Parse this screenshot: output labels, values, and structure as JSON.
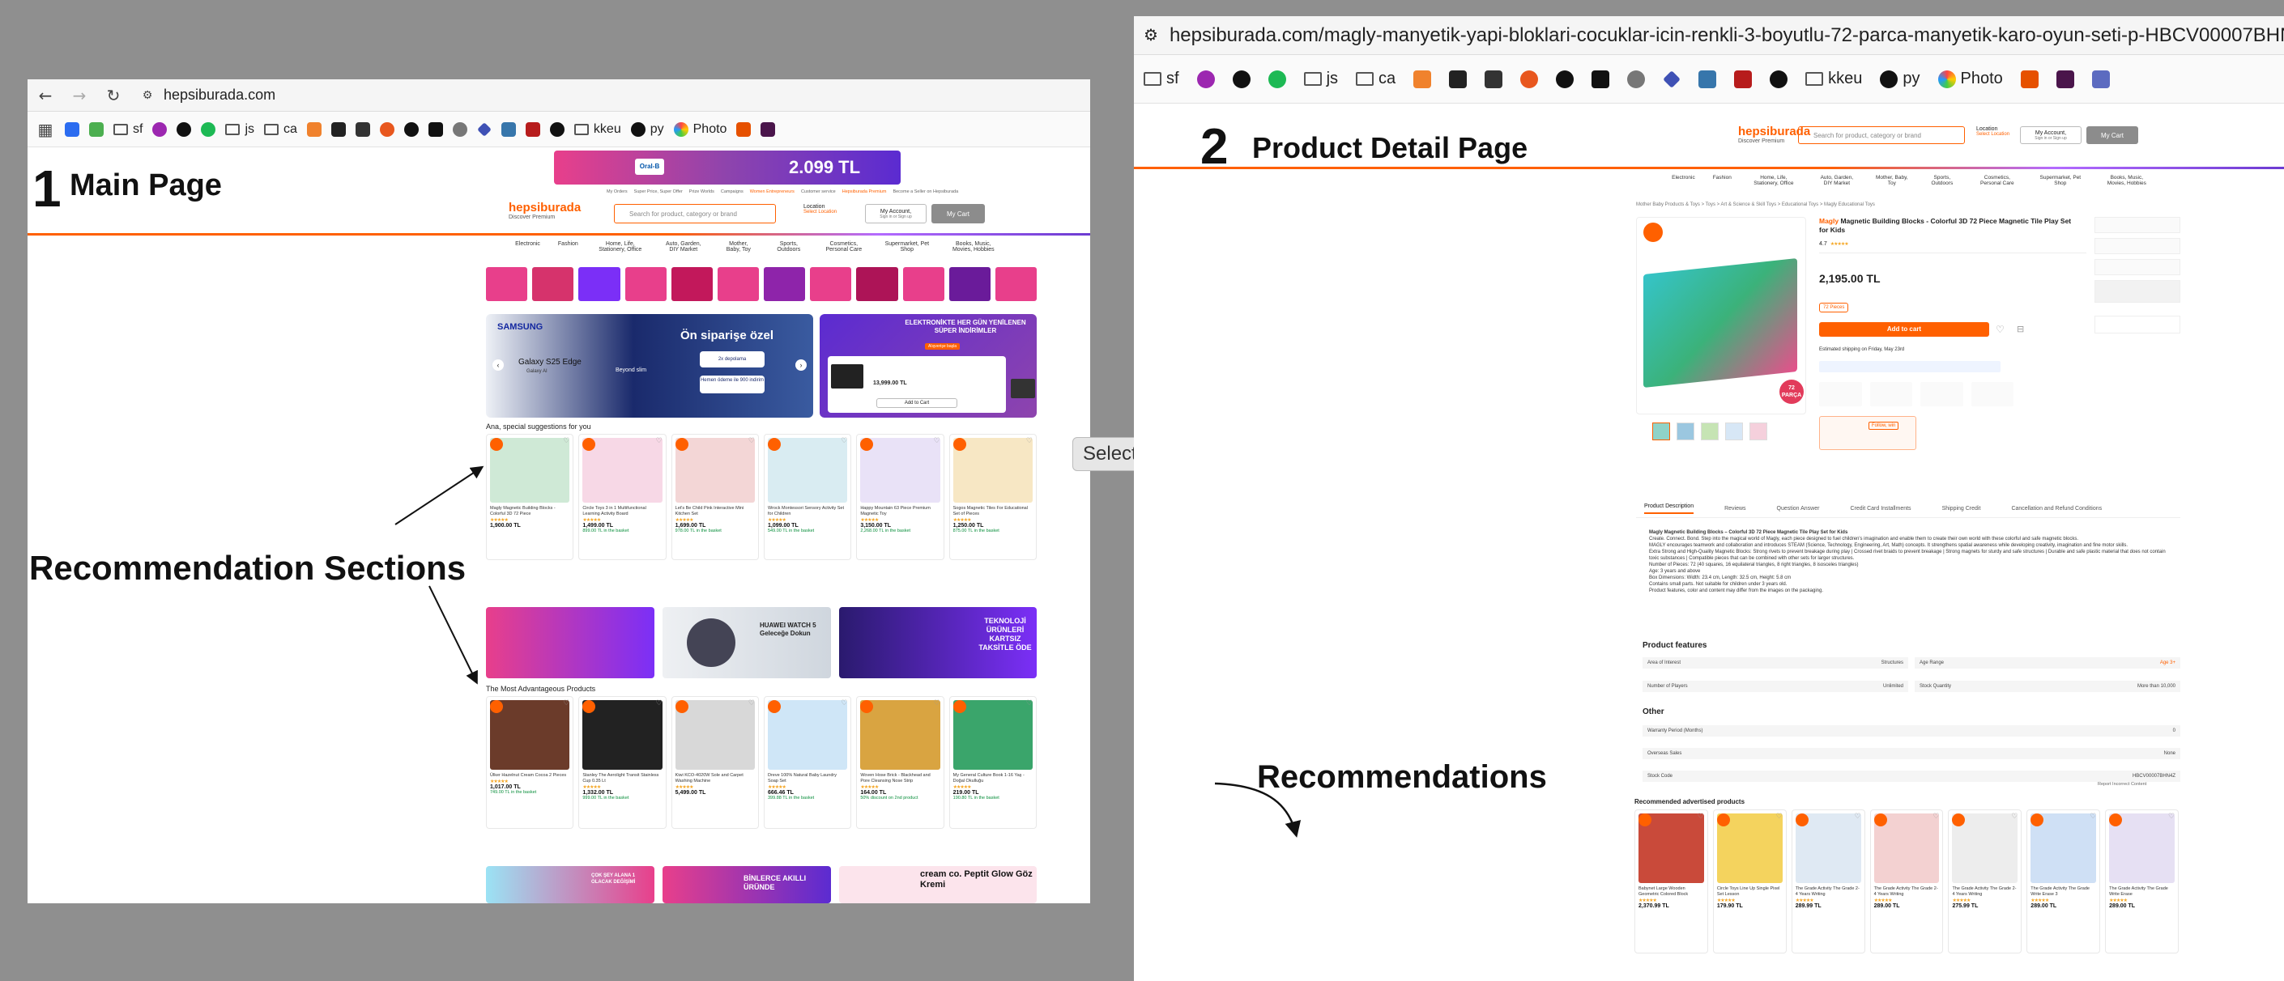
{
  "left": {
    "url": "hepsiburada.com",
    "bookmarks": [
      "sf",
      "js",
      "ca",
      "py",
      "Photo",
      "kkeu"
    ],
    "section_number": "1",
    "section_title": "Main Page",
    "site": {
      "logo": "hepsiburada",
      "logo_sub": "Discover Premium",
      "search_placeholder": "Search for product, category or brand",
      "location_label": "Location",
      "location_sub": "Select Location",
      "account_label": "My Account,",
      "account_sub": "Sign in or Sign up",
      "cart_label": "My Cart",
      "top_links": [
        "My Orders",
        "Super Price, Super Offer",
        "Prize Worlds",
        "Campaigns",
        "Women Entrepreneurs",
        "Customer service",
        "Hepsiburada Premium",
        "Become a Seller on Hepsiburada"
      ],
      "categories": [
        "Electronic",
        "Fashion",
        "Home, Life, Stationery, Office",
        "Auto, Garden, DIY Market",
        "Mother, Baby, Toy",
        "Sports, Outdoors",
        "Cosmetics, Personal Care",
        "Supermarket, Pet Shop",
        "Books, Music, Movies, Hobbies"
      ],
      "promo_price": "2.099 TL",
      "promo_brand": "Oral-B",
      "banner_left": {
        "brand": "SAMSUNG",
        "model": "Galaxy S25 Edge",
        "model_sub": "Galaxy AI",
        "tagline": "Beyond slim",
        "headline": "Ön siparişe özel",
        "pill1": "2x depolama",
        "pill2": "Hemen ödeme ile 900 indirim"
      },
      "banner_right": {
        "headline": "ELEKTRONİKTE HER GÜN YENİLENEN SÜPER İNDİRİMLER",
        "link": "Alışverişe başla",
        "price": "13,999.00 TL",
        "button": "Add to Cart"
      },
      "rec_heading": "Ana, special suggestions for you",
      "adv_heading": "The Most Advantageous Products",
      "rec_products": [
        {
          "title": "Magly Magnetic Building Blocks - Colorful 3D 72 Piece",
          "price": "1,900.00 TL",
          "green": ""
        },
        {
          "title": "Circle Toys 3 in 1 Multifunctional Learning Activity Board",
          "price": "1,499.00 TL",
          "green": "899.00 TL in the basket"
        },
        {
          "title": "Let's Be Child Pink Interactive Mini Kitchen Set",
          "price": "1,699.00 TL",
          "green": "978.00 TL in the basket"
        },
        {
          "title": "Wrock Montessori Sensory Activity Set for Children",
          "price": "1,099.00 TL",
          "green": "549.00 TL in the basket"
        },
        {
          "title": "Happy Mountain 63 Piece Premium Magnetic Toy",
          "price": "3,150.00 TL",
          "green": "2,268.00 TL in the basket"
        },
        {
          "title": "Sogos Magnetic Tiles For Educational Set of Pieces",
          "price": "1,250.00 TL",
          "green": "875.00 TL in the basket"
        }
      ],
      "adv_products": [
        {
          "title": "Ülker Hazelnut Cream Cocoa 2 Pieces",
          "price": "1,017.00 TL",
          "green": "749.00 TL in the basket"
        },
        {
          "title": "Stanley The Aerolight Transit Stainless Cup 0.35 Lt",
          "price": "1,332.00 TL",
          "green": "999.00 TL in the basket"
        },
        {
          "title": "Kiwi KCO-4020W Sole and Carpet Washing Machine",
          "price": "5,499.00 TL",
          "green": ""
        },
        {
          "title": "Dreve 100% Natural Baby Laundry Soap Set",
          "price": "666.46 TL",
          "green": "399.88 TL in the basket"
        },
        {
          "title": "Woven Hose Brick - Blackhead and Pore Cleansing Nose Strip",
          "price": "164.00 TL",
          "green": "50% discount on 2nd product"
        },
        {
          "title": "My General Culture Book 1-16 Yaş - Doğal Okulluğu",
          "price": "219.00 TL",
          "green": "190.80 TL in the basket"
        }
      ],
      "bottom_banners": [
        "ÇOK ŞEY ALANA 1 OLACAK DEĞİŞİMİ",
        "BİNLERCE AKILLI ÜRÜNDE",
        "cream co. Peptit Glow Göz Kremi"
      ],
      "mid_banner2": "HUAWEI WATCH 5 Geleceğe Dokun",
      "mid_banner3": "TEKNOLOJİ ÜRÜNLERİ KARTSIZ TAKSİTLE ÖDE"
    },
    "annotation": "Recommendation Sections"
  },
  "right": {
    "url": "hepsiburada.com/magly-manyetik-yapi-bloklari-cocuklar-icin-renkli-3-boyutlu-72-parca-manyetik-karo-oyun-seti-p-HBCV00007BHN4Z",
    "bookmarks": [
      "sf",
      "js",
      "ca",
      "kkeu",
      "py",
      "Photo"
    ],
    "section_number": "2",
    "section_title": "Product Detail Page",
    "breadcrumb": "Mother Baby Products & Toys > Toys > Art & Science & Skill Toys > Educational Toys > Magly Educational Toys",
    "product": {
      "brand": "Magly",
      "title": "Magnetic Building Blocks - Colorful 3D 72 Piece Magnetic Tile Play Set for Kids",
      "rating": "4.7",
      "price": "2,195.00 TL",
      "piece_label": "72 Pieces",
      "add_to_cart": "Add to cart",
      "badge": "72 PARÇA",
      "coupon": "Follow, win",
      "delivery": "Estimated shipping on Friday, May 23rd"
    },
    "tabs": [
      "Product Description",
      "Reviews",
      "Question Answer",
      "Credit Card Installments",
      "Shipping Credit",
      "Cancellation and Refund Conditions"
    ],
    "desc_title": "Magly Magnetic Building Blocks – Colorful 3D 72 Piece Magnetic Tile Play Set for Kids",
    "desc_lines": [
      "Create. Connect. Bond. Step into the magical world of Magly, each piece designed to fuel children's imagination and enable them to create their own world with these colorful and safe magnetic blocks.",
      "MAGLY encourages teamwork and collaboration and introduces STEAM (Science, Technology, Engineering, Art, Math) concepts. It strengthens spatial awareness while developing creativity, imagination and fine motor skills.",
      "Extra Strong and High-Quality Magnetic Blocks: Strong rivets to prevent breakage during play | Crossed rivet braids to prevent breakage | Strong magnets for sturdy and safe structures | Durable and safe plastic material that does not contain toxic substances | Compatible pieces that can be combined with other sets for larger structures.",
      "Number of Pieces: 72 (40 squares, 16 equilateral triangles, 8 right triangles, 8 isosceles triangles)",
      "Age: 3 years and above",
      "Box Dimensions: Width: 23.4 cm, Length: 32.5 cm, Height: 5.8 cm",
      "Contains small parts. Not suitable for children under 3 years old.",
      "Product features, color and content may differ from the images on the packaging."
    ],
    "features_heading": "Product features",
    "features": [
      {
        "k": "Area of Interest",
        "v": "Structures",
        "k2": "Age Range",
        "v2": "Age 3+"
      },
      {
        "k": "Number of Players",
        "v": "Unlimited",
        "k2": "Stock Quantity",
        "v2": "More than 10,000"
      }
    ],
    "other_heading": "Other",
    "other": [
      {
        "k": "Warranty Period (Months)",
        "v": "0"
      },
      {
        "k": "Overseas Sales",
        "v": "None"
      },
      {
        "k": "Stock Code",
        "v": "HBCV00007BHN4Z"
      }
    ],
    "report": "Report Incorrect Content",
    "rec_heading": "Recommended advertised products",
    "rec_products": [
      {
        "title": "Babynet Large Wooden Geometric Colored Block",
        "price": "2,370.99 TL"
      },
      {
        "title": "Circle Toys Line Up Single Pixel Set Lesson",
        "price": "179.90 TL"
      },
      {
        "title": "The Grade Activity The Grade 2-4 Years Writing",
        "price": "289.99 TL"
      },
      {
        "title": "The Grade Activity The Grade 2-4 Years Writing",
        "price": "289.00 TL"
      },
      {
        "title": "The Grade Activity The Grade 2-4 Years Writing",
        "price": "275.99 TL"
      },
      {
        "title": "The Grade Activity The Grade Write Erase 3",
        "price": "289.00 TL"
      },
      {
        "title": "The Grade Activity The Grade Write Erase",
        "price": "289.00 TL"
      }
    ],
    "annotation": "Recommendations"
  },
  "selection_tools": "Selection Tools",
  "colors": {
    "accent": "#ff6000",
    "purple": "#6c3bd1",
    "pink": "#e83f8b"
  }
}
